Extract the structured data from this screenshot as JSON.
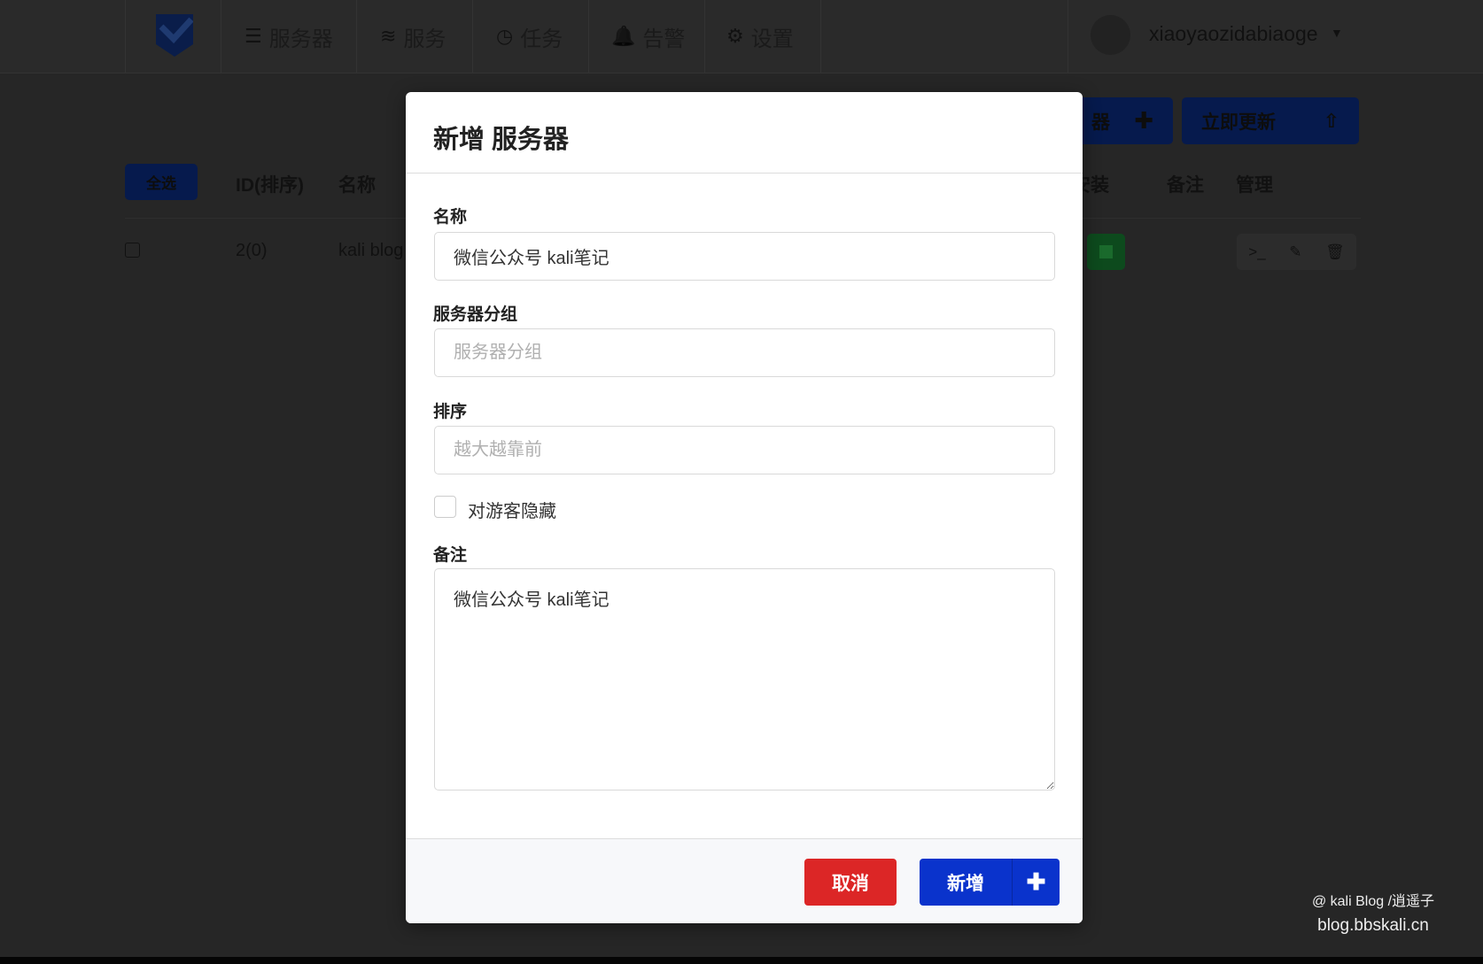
{
  "nav": {
    "items": [
      {
        "icon": "server-icon",
        "glyph": "☰",
        "label": "服务器"
      },
      {
        "icon": "rss-icon",
        "glyph": "≋",
        "label": "服务"
      },
      {
        "icon": "clock-icon",
        "glyph": "◷",
        "label": "任务"
      },
      {
        "icon": "bell-icon",
        "glyph": "🔔",
        "label": "告警"
      },
      {
        "icon": "gear-icon",
        "glyph": "⚙",
        "label": "设置"
      }
    ],
    "username": "xiaoyaozidabiaoge"
  },
  "toolbar": {
    "add_server_partial": "器",
    "update_now": "立即更新"
  },
  "table": {
    "select_all": "全选",
    "headers": {
      "id": "ID(排序)",
      "name": "名称",
      "install": "安装",
      "note": "备注",
      "manage": "管理"
    },
    "rows": [
      {
        "id": "2(0)",
        "name": "kali blog"
      }
    ]
  },
  "modal": {
    "title": "新增 服务器",
    "name_label": "名称",
    "name_value": "微信公众号 kali笔记",
    "group_label": "服务器分组",
    "group_placeholder": "服务器分组",
    "order_label": "排序",
    "order_placeholder": "越大越靠前",
    "hide_label": "对游客隐藏",
    "hide_checked": false,
    "note_label": "备注",
    "note_value": "微信公众号 kali笔记",
    "cancel": "取消",
    "submit": "新增"
  },
  "watermark": {
    "line1": "@ kali Blog /逍遥子",
    "line2": "blog.bbskali.cn"
  },
  "colors": {
    "primary": "#0a33cc",
    "danger": "#dc2626",
    "footer_bg": "#f7f8fa"
  }
}
